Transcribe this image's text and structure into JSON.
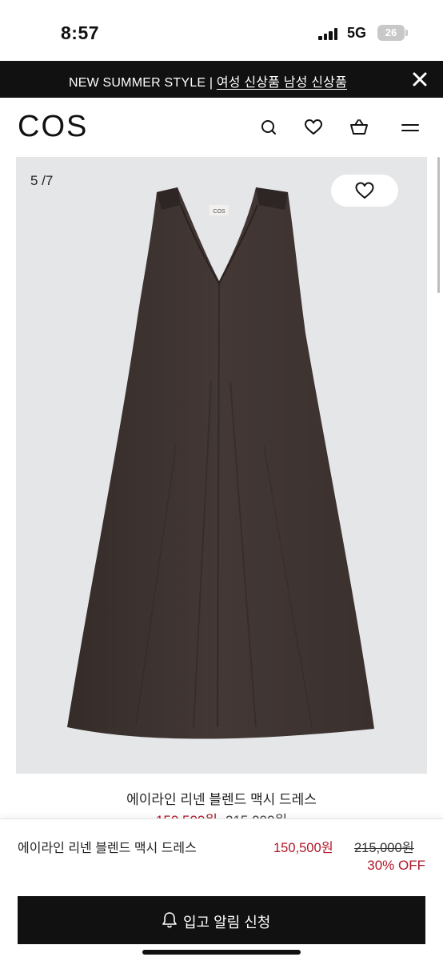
{
  "status_bar": {
    "time": "8:57",
    "network": "5G",
    "battery": "26"
  },
  "promo": {
    "text": "NEW SUMMER STYLE | ",
    "link": "여성 신상품 남성 신상품",
    "close_icon": "close-icon"
  },
  "header": {
    "logo": "COS",
    "icons": [
      "search-icon",
      "heart-icon",
      "bag-icon",
      "menu-icon"
    ]
  },
  "gallery": {
    "counter": "5 /7",
    "garment_label": "COS",
    "wishlist_icon": "heart-icon",
    "background": "#e5e6e8",
    "garment_color": "#3d3330"
  },
  "product": {
    "name": "에이라인 리넨 블렌드 맥시 드레스",
    "sale_price": "150,500원",
    "original_price": "215,000원",
    "discount": "30% OFF",
    "accent_color": "#b0182a"
  },
  "cta": {
    "label": "입고 알림 신청",
    "icon": "bell-icon"
  }
}
